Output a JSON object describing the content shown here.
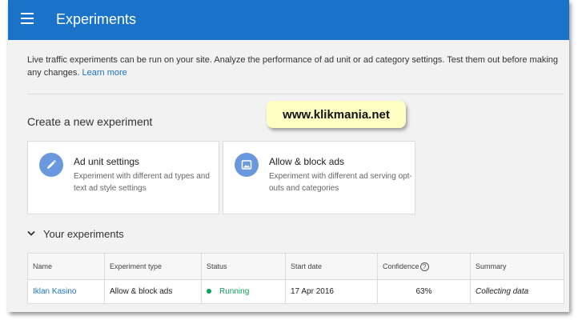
{
  "header": {
    "title": "Experiments",
    "menu_icon": "menu-icon"
  },
  "intro": {
    "text": "Live traffic experiments can be run on your site. Analyze the performance of ad unit or ad category settings. Test them out before making any changes.",
    "link": "Learn more"
  },
  "create": {
    "title": "Create a new experiment",
    "cards": [
      {
        "title": "Ad unit settings",
        "description": "Experiment with different ad types and text ad style settings",
        "icon": "pencil-icon"
      },
      {
        "title": "Allow & block ads",
        "description": "Experiment with different ad serving opt-outs and categories",
        "icon": "image-icon"
      }
    ]
  },
  "watermark": "www.klikmania.net",
  "your_experiments": {
    "title": "Your experiments",
    "columns": [
      "Name",
      "Experiment type",
      "Status",
      "Start date",
      "Confidence",
      "Summary"
    ],
    "rows": [
      {
        "name": "Iklan Kasino",
        "type": "Allow & block ads",
        "status": "Running",
        "start_date": "17 Apr 2016",
        "confidence": "63%",
        "summary": "Collecting data"
      }
    ]
  },
  "colors": {
    "appbar": "#1a73c8",
    "link": "#1a73c8",
    "running": "#0f9d58",
    "card_icon": "#6a98df"
  }
}
